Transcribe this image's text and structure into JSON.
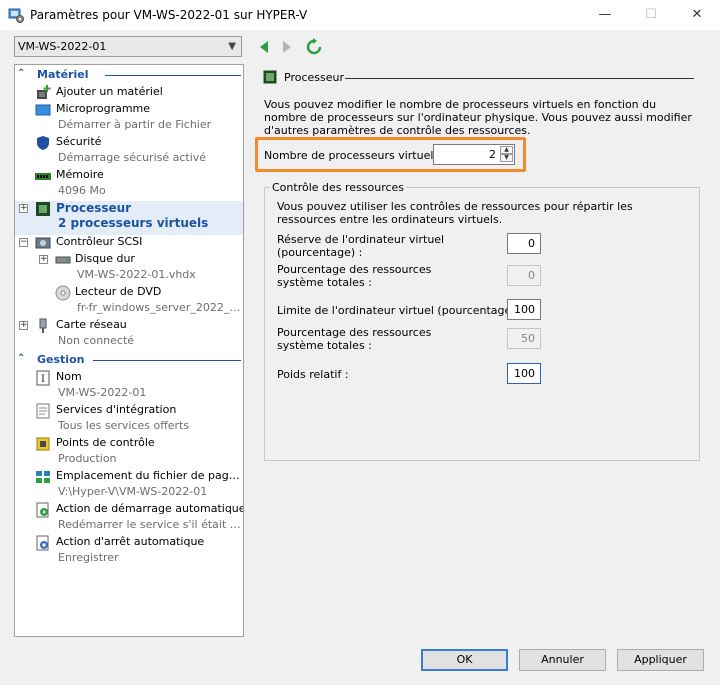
{
  "window": {
    "title": "Paramètres pour VM-WS-2022-01 sur HYPER-V",
    "minimize": "—",
    "maximize": "☐",
    "close": "✕"
  },
  "vm_selector": {
    "value": "VM-WS-2022-01"
  },
  "tree": {
    "hardware_header": "Matériel",
    "management_header": "Gestion",
    "hardware_items": [
      {
        "main": "Ajouter un matériel",
        "sub": "",
        "icon": "add-hardware-icon"
      },
      {
        "main": "Microprogramme",
        "sub": "Démarrer à partir de Fichier",
        "icon": "firmware-icon"
      },
      {
        "main": "Sécurité",
        "sub": "Démarrage sécurisé activé",
        "icon": "shield-icon"
      },
      {
        "main": "Mémoire",
        "sub": "4096 Mo",
        "icon": "memory-icon"
      },
      {
        "main": "Processeur",
        "sub": "2 processeurs virtuels",
        "icon": "processor-icon"
      },
      {
        "main": "Contrôleur SCSI",
        "sub": "",
        "icon": "scsi-controller-icon"
      },
      {
        "main": "Disque dur",
        "sub": "VM-WS-2022-01.vhdx",
        "icon": "hard-disk-icon"
      },
      {
        "main": "Lecteur de DVD",
        "sub": "fr-fr_windows_server_2022_u...",
        "icon": "dvd-icon"
      },
      {
        "main": "Carte réseau",
        "sub": "Non connecté",
        "icon": "network-adapter-icon"
      }
    ],
    "management_items": [
      {
        "main": "Nom",
        "sub": "VM-WS-2022-01",
        "icon": "name-icon"
      },
      {
        "main": "Services d'intégration",
        "sub": "Tous les services offerts",
        "icon": "integration-services-icon"
      },
      {
        "main": "Points de contrôle",
        "sub": "Production",
        "icon": "checkpoint-icon"
      },
      {
        "main": "Emplacement du fichier de paginati...",
        "sub": "V:\\Hyper-V\\VM-WS-2022-01",
        "icon": "paging-file-icon"
      },
      {
        "main": "Action de démarrage automatique",
        "sub": "Redémarrer le service s'il était en c...",
        "icon": "auto-start-icon"
      },
      {
        "main": "Action d'arrêt automatique",
        "sub": "Enregistrer",
        "icon": "auto-stop-icon"
      }
    ]
  },
  "processor": {
    "header": "Processeur",
    "description": "Vous pouvez modifier le nombre de processeurs virtuels en fonction du nombre de processeurs sur l'ordinateur physique. Vous pouvez aussi modifier d'autres paramètres de contrôle des ressources.",
    "vcpu_label": "Nombre de processeurs virtuels :",
    "vcpu_value": "2",
    "resource_group": {
      "title": "Contrôle des ressources",
      "description": "Vous pouvez utiliser les contrôles de ressources pour répartir les ressources entre les ordinateurs virtuels.",
      "reserve_label": "Réserve de l'ordinateur virtuel (pourcentage) :",
      "reserve_value": "0",
      "reserve_pct_label": "Pourcentage des ressources système totales :",
      "reserve_pct_value": "0",
      "limit_label": "Limite de l'ordinateur virtuel (pourcentage) :",
      "limit_value": "100",
      "limit_pct_label": "Pourcentage des ressources système totales :",
      "limit_pct_value": "50",
      "weight_label": "Poids relatif :",
      "weight_value": "100"
    }
  },
  "buttons": {
    "ok": "OK",
    "cancel": "Annuler",
    "apply": "Appliquer"
  },
  "colors": {
    "accent": "#1c53a4",
    "highlight": "#f38a2c",
    "selected_bg": "#e3ecf7"
  }
}
